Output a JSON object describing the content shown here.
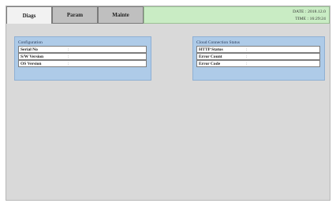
{
  "tabs": [
    {
      "label": "Diags",
      "active": true
    },
    {
      "label": "Param",
      "active": false
    },
    {
      "label": "Mainte",
      "active": false
    }
  ],
  "status": {
    "date_text": "DATE : 2018.12.0",
    "time_text": "TIME : 16:29:24",
    "color": "#c9ecc4"
  },
  "configuration": {
    "title": "Configuration",
    "rows": [
      {
        "label": "Serial No",
        "sep": ":"
      },
      {
        "label": "S/W Version",
        "sep": ":"
      },
      {
        "label": "OS Version",
        "sep": ":"
      }
    ]
  },
  "cloud": {
    "title": "Cloud Connection Status",
    "rows": [
      {
        "label": "HTTP Status",
        "sep": ":"
      },
      {
        "label": "Error Count",
        "sep": ":"
      },
      {
        "label": "Error Code",
        "sep": ":"
      }
    ]
  },
  "colors": {
    "panel": "#aecbe8",
    "background": "#d9d9d9"
  }
}
